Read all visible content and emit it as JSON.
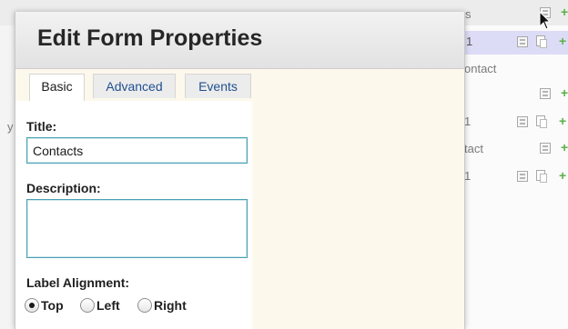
{
  "background": {
    "rows": [
      {
        "text": "s"
      },
      {
        "text": "1"
      },
      {
        "text": "ontact"
      },
      {
        "text": ""
      },
      {
        "text": "1"
      },
      {
        "text": "tact"
      },
      {
        "text": "1"
      }
    ],
    "left_char": "y"
  },
  "dialog": {
    "title": "Edit Form Properties",
    "tabs": [
      {
        "label": "Basic",
        "active": true
      },
      {
        "label": "Advanced",
        "active": false
      },
      {
        "label": "Events",
        "active": false
      }
    ],
    "fields": {
      "title_label": "Title:",
      "title_value": "Contacts",
      "description_label": "Description:",
      "description_value": "",
      "label_alignment_label": "Label Alignment:"
    },
    "alignment_options": [
      {
        "label": "Top",
        "checked": true
      },
      {
        "label": "Left",
        "checked": false
      },
      {
        "label": "Right",
        "checked": false
      }
    ]
  },
  "colors": {
    "dialog_bg": "#fdf8ec",
    "input_border": "#4aa0b4",
    "tab_link": "#20508f",
    "highlight_row": "#dcdcf6"
  }
}
